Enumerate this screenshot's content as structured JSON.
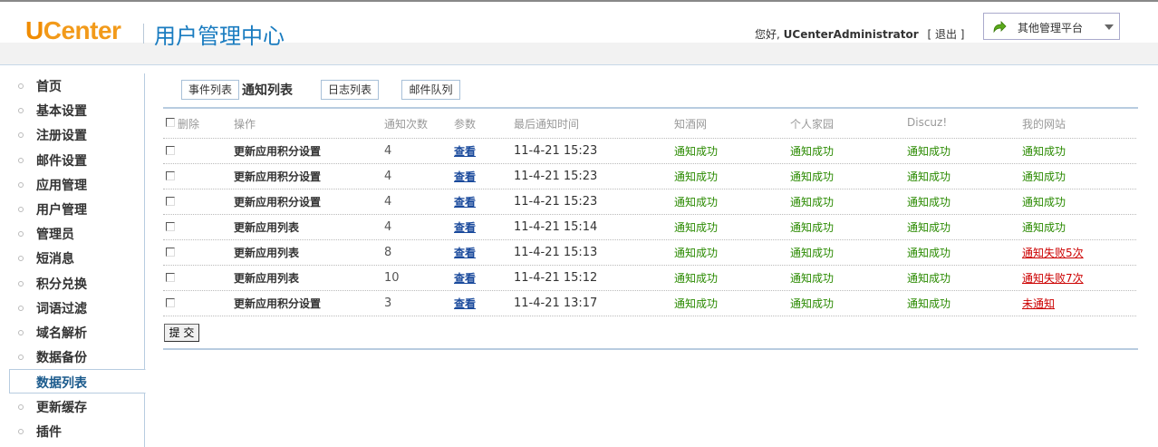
{
  "header": {
    "logo_u": "U",
    "logo_rest": "Center",
    "title": "用户管理中心",
    "greeting_prefix": "您好,",
    "username": "UCenterAdministrator",
    "logout": "[ 退出 ]",
    "platform_label": "其他管理平台"
  },
  "sidebar": {
    "items": [
      {
        "label": "首页"
      },
      {
        "label": "基本设置"
      },
      {
        "label": "注册设置"
      },
      {
        "label": "邮件设置"
      },
      {
        "label": "应用管理"
      },
      {
        "label": "用户管理"
      },
      {
        "label": "管理员"
      },
      {
        "label": "短消息"
      },
      {
        "label": "积分兑换"
      },
      {
        "label": "词语过滤"
      },
      {
        "label": "域名解析"
      },
      {
        "label": "数据备份"
      },
      {
        "label": "数据列表",
        "active": true
      },
      {
        "label": "更新缓存"
      },
      {
        "label": "插件"
      }
    ]
  },
  "tabs": {
    "event_list": "事件列表",
    "current": "通知列表",
    "log_list": "日志列表",
    "mail_queue": "邮件队列"
  },
  "table": {
    "headers": {
      "delete": "删除",
      "operation": "操作",
      "notify_count": "通知次数",
      "params": "参数",
      "last_time": "最后通知时间",
      "app1": "知酒网",
      "app2": "个人家园",
      "app3": "Discuz!",
      "app4": "我的网站"
    },
    "rows": [
      {
        "op": "更新应用积分设置",
        "count": "4",
        "param": "查看",
        "time": "11-4-21 15:23",
        "a1": "通知成功",
        "a2": "通知成功",
        "a3": "通知成功",
        "a4": "通知成功",
        "a4_fail": false
      },
      {
        "op": "更新应用积分设置",
        "count": "4",
        "param": "查看",
        "time": "11-4-21 15:23",
        "a1": "通知成功",
        "a2": "通知成功",
        "a3": "通知成功",
        "a4": "通知成功",
        "a4_fail": false
      },
      {
        "op": "更新应用积分设置",
        "count": "4",
        "param": "查看",
        "time": "11-4-21 15:23",
        "a1": "通知成功",
        "a2": "通知成功",
        "a3": "通知成功",
        "a4": "通知成功",
        "a4_fail": false
      },
      {
        "op": "更新应用列表",
        "count": "4",
        "param": "查看",
        "time": "11-4-21 15:14",
        "a1": "通知成功",
        "a2": "通知成功",
        "a3": "通知成功",
        "a4": "通知成功",
        "a4_fail": false
      },
      {
        "op": "更新应用列表",
        "count": "8",
        "param": "查看",
        "time": "11-4-21 15:13",
        "a1": "通知成功",
        "a2": "通知成功",
        "a3": "通知成功",
        "a4": "通知失败5次",
        "a4_fail": true
      },
      {
        "op": "更新应用列表",
        "count": "10",
        "param": "查看",
        "time": "11-4-21 15:12",
        "a1": "通知成功",
        "a2": "通知成功",
        "a3": "通知成功",
        "a4": "通知失败7次",
        "a4_fail": true
      },
      {
        "op": "更新应用积分设置",
        "count": "3",
        "param": "查看",
        "time": "11-4-21 13:17",
        "a1": "通知成功",
        "a2": "通知成功",
        "a3": "通知成功",
        "a4": "未通知",
        "a4_fail": true
      }
    ]
  },
  "submit_label": "提 交",
  "colors": {
    "accent_blue": "#1a7cc0",
    "logo_orange": "#f08c00",
    "success_green": "#2a8a00",
    "fail_red": "#cc0000"
  },
  "icons": {
    "platform": "green-arrow-icon",
    "dropdown": "chevron-down-icon",
    "nav_bullet": "circle-bullet-icon"
  }
}
